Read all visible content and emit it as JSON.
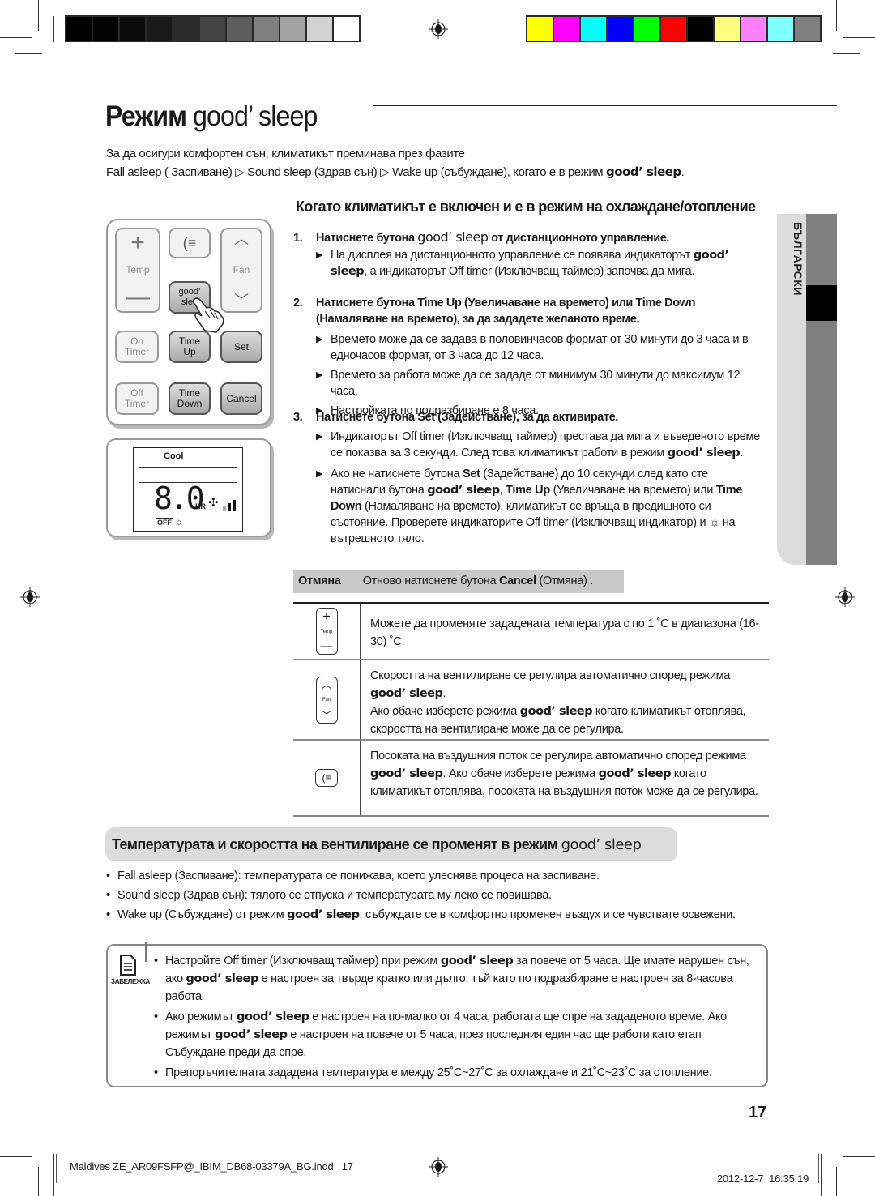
{
  "color_bars": {
    "grayscale": [
      "#000000",
      "#030303",
      "#0b0b0b",
      "#1a1a1a",
      "#2b2b2b",
      "#444444",
      "#5e5e5e",
      "#808080",
      "#a2a2a2",
      "#d2d2d2",
      "#ffffff"
    ],
    "colors": [
      "#ffff00",
      "#ff00ff",
      "#00ffff",
      "#0000ff",
      "#00ff00",
      "#ff0000",
      "#000000",
      "#ffff80",
      "#ff80ff",
      "#80ffff",
      "#808080"
    ]
  },
  "title": {
    "prefix": "Режим",
    "brand": "good’ sleep"
  },
  "intro": {
    "line1": "За да осигури комфортен сън, климатикът преминава през фазите",
    "phase1": "Fall asleep ( Заспиване)",
    "arrow": "▷",
    "phase2": "Sound sleep (Здрав сън)",
    "phase3": "Wake up (събуждане), когато е в режим",
    "brand": "good’ sleep",
    "end": "."
  },
  "side_tab": {
    "label": "БЪЛГАРСКИ"
  },
  "section1": {
    "heading": "Когато климатикът е включен и е в режим на охлаждане/отопление",
    "steps": [
      {
        "num": "1.",
        "pre": "Натиснете бутона",
        "brand": "good’ sleep",
        "post": "от дистанционното управление.",
        "bullets": [
          {
            "line1": "На дисплея на дистанционното управление се появява индикаторът",
            "brand": "good’ sleep",
            "line2": ", а индикаторът Off timer (Изключващ таймер) започва да мига."
          }
        ]
      },
      {
        "num": "2.",
        "title_line1": "Натиснете бутона Time Up (Увеличаване на времето) или Time Down",
        "title_line2": "(Намаляване на времето), за да зададете желаното време.",
        "bullets": [
          "Времето може да се задава в половинчасов формат от 30 минути до 3 часа и в едночасов формат, от 3 часа до 12 часа.",
          "Времето за работа може да се зададе от минимум 30 минути до максимум 12 часа.",
          "Настройката по подразбиране е 8 часа."
        ]
      },
      {
        "num": "3.",
        "title": "Натиснете бутона Set (Задействане), за да активирате.",
        "bullet1": {
          "text": "Индикаторът Off timer (Изключващ таймер) престава да мига и въведеното време се показва за 3 секунди. След това климатикът работи в режим",
          "brand": "good’ sleep",
          "end": "."
        },
        "bullet2": {
          "p1": "Ако не натиснете бутона",
          "b1": "Set",
          "p2": "(Задействане) до 10 секунди след като сте натиснали бутона",
          "brand": "good’ sleep",
          "p3": ",",
          "b2": "Time Up",
          "p4": "(Увеличаване на времето) или",
          "b3": "Time Down",
          "p5": "(Намаляване на времето), климатикът се връща в предишното си състояние. Проверете индикаторите Off timer (Изключващ индикатор) и",
          "p6": "на вътрешното тяло."
        }
      }
    ],
    "cancel": {
      "label": "Отмяна",
      "pre": "Отново натиснете бутона",
      "bold": "Cancel",
      "post": "(Отмяна) ."
    }
  },
  "remote": {
    "temp_label": "Temp",
    "fan_label": "Fan",
    "good_sleep_label_1": "good’",
    "good_sleep_label_2": "slee",
    "on_timer_1": "On",
    "on_timer_2": "Timer",
    "time_up_1": "Time",
    "time_up_2": "Up",
    "set": "Set",
    "off_timer_1": "Off",
    "off_timer_2": "Timer",
    "time_down_1": "Time",
    "time_down_2": "Down",
    "cancel": "Cancel"
  },
  "display": {
    "mode": "Cool",
    "time_value": "8.0",
    "unit": "HR",
    "off_badge": "OFF",
    "fan_level_bars": 3,
    "fan_level_active": 2
  },
  "button_table": [
    {
      "icon": "temp-button-icon",
      "icon_label": "Temp",
      "text1": "Можете да променяте зададената температура с по 1 ˚C в диапазона (16-30) ˚C."
    },
    {
      "icon": "fan-button-icon",
      "icon_label": "Fan",
      "text1": "Скоростта на вентилиране се регулира автоматично според режима",
      "brand1": "good’ sleep",
      "end1": ".",
      "text2": "Ако обаче изберете режима",
      "brand2": "good’ sleep",
      "text3": "когато климатикът отоплява, скоростта на вентилиране може да се регулира."
    },
    {
      "icon": "airflow-button-icon",
      "text1": "Посоката на въздушния поток се регулира автоматично според режима",
      "brand1": "good’ sleep",
      "text2": ". Ако обаче изберете режима",
      "brand2": "good’ sleep",
      "text3": "когато климатикът отоплява, посоката на въздушния поток може да се регулира."
    }
  ],
  "section2": {
    "heading": "Температурата и скоростта на вентилиране се променят в режим",
    "brand": "good’ sleep",
    "items": [
      {
        "text": "Fall asleep (Заспиване): температурата се понижава, което улеснява процеса на заспиване."
      },
      {
        "text": "Sound sleep (Здрав сън): тялото се отпуска и температурата му леко се повишава."
      },
      {
        "pre": "Wake up (Събуждане) от режим",
        "brand": "good’ sleep",
        "post": ": събуждате се в комфортно променен въздух и се чувствате освежени."
      }
    ]
  },
  "note": {
    "label": "ЗАБЕЛЕЖКА",
    "items": [
      {
        "p1": "Настройте Off timer (Изключващ таймер) при режим",
        "b1": "good’ sleep",
        "p2": "за повече от 5 часа. Ще имате нарушен сън, ако",
        "b2": "good’ sleep",
        "p3": "е настроен за твърде кратко или дълго, тъй като по подразбиране е настроен за 8-часова работа"
      },
      {
        "p1": "Ако режимът",
        "b1": "good’ sleep",
        "p2": "е настроен на по-малко от 4 часа, работата ще спре на зададеното време. Ако режимът",
        "b2": "good’ sleep",
        "p3": "е настроен на повече от 5 часа, през последния един час ще работи като етап Събуждане преди да спре."
      },
      {
        "p1": "Препоръчителната зададена температура е между 25˚C~27˚C за охлаждане и 21˚C~23˚C за отопление."
      }
    ]
  },
  "page_number": "17",
  "footer": {
    "file": "Maldives ZE_AR09FSFP@_IBIM_DB68-03379A_BG.indd   17",
    "date": "2012-12-7",
    "time": "16:35:19"
  }
}
